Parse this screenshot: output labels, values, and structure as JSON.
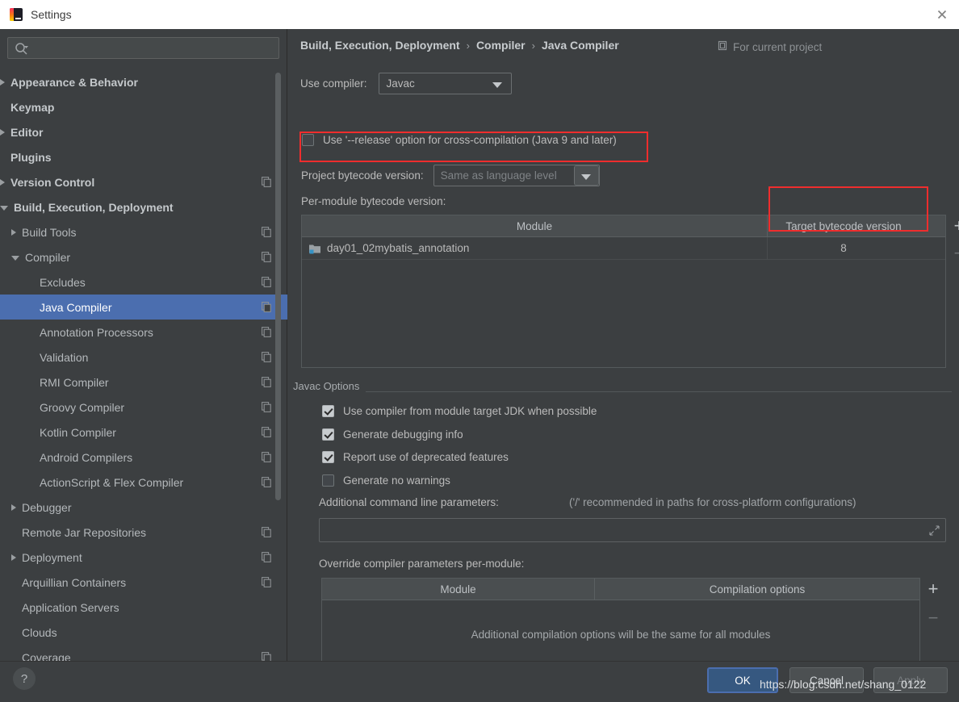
{
  "window": {
    "title": "Settings",
    "app_icon": "intellij-idea-icon",
    "close_icon": "close-icon"
  },
  "sidebar": {
    "search": {
      "placeholder": "",
      "value": "",
      "icon": "search-icon"
    },
    "items": [
      {
        "label": "Appearance & Behavior",
        "arrow": "right",
        "bold": true,
        "indent": 14,
        "copy": false
      },
      {
        "label": "Keymap",
        "arrow": "none",
        "bold": true,
        "indent": 14,
        "copy": false
      },
      {
        "label": "Editor",
        "arrow": "right",
        "bold": true,
        "indent": 14,
        "copy": false
      },
      {
        "label": "Plugins",
        "arrow": "none",
        "bold": true,
        "indent": 14,
        "copy": false
      },
      {
        "label": "Version Control",
        "arrow": "right",
        "bold": true,
        "indent": 14,
        "copy": true
      },
      {
        "label": "Build, Execution, Deployment",
        "arrow": "down",
        "bold": true,
        "indent": 14,
        "copy": false
      },
      {
        "label": "Build Tools",
        "arrow": "right",
        "bold": false,
        "indent": 34,
        "copy": true
      },
      {
        "label": "Compiler",
        "arrow": "down",
        "bold": false,
        "indent": 34,
        "copy": true
      },
      {
        "label": "Excludes",
        "arrow": "none",
        "bold": false,
        "indent": 56,
        "copy": true
      },
      {
        "label": "Java Compiler",
        "arrow": "none",
        "bold": false,
        "indent": 56,
        "copy": true,
        "selected": true
      },
      {
        "label": "Annotation Processors",
        "arrow": "none",
        "bold": false,
        "indent": 56,
        "copy": true
      },
      {
        "label": "Validation",
        "arrow": "none",
        "bold": false,
        "indent": 56,
        "copy": true
      },
      {
        "label": "RMI Compiler",
        "arrow": "none",
        "bold": false,
        "indent": 56,
        "copy": true
      },
      {
        "label": "Groovy Compiler",
        "arrow": "none",
        "bold": false,
        "indent": 56,
        "copy": true
      },
      {
        "label": "Kotlin Compiler",
        "arrow": "none",
        "bold": false,
        "indent": 56,
        "copy": true
      },
      {
        "label": "Android Compilers",
        "arrow": "none",
        "bold": false,
        "indent": 56,
        "copy": true
      },
      {
        "label": "ActionScript & Flex Compiler",
        "arrow": "none",
        "bold": false,
        "indent": 56,
        "copy": true
      },
      {
        "label": "Debugger",
        "arrow": "right",
        "bold": false,
        "indent": 34,
        "copy": false
      },
      {
        "label": "Remote Jar Repositories",
        "arrow": "none",
        "bold": false,
        "indent": 34,
        "copy": true
      },
      {
        "label": "Deployment",
        "arrow": "right",
        "bold": false,
        "indent": 34,
        "copy": true
      },
      {
        "label": "Arquillian Containers",
        "arrow": "none",
        "bold": false,
        "indent": 34,
        "copy": true
      },
      {
        "label": "Application Servers",
        "arrow": "none",
        "bold": false,
        "indent": 34,
        "copy": false
      },
      {
        "label": "Clouds",
        "arrow": "none",
        "bold": false,
        "indent": 34,
        "copy": false
      },
      {
        "label": "Coverage",
        "arrow": "none",
        "bold": false,
        "indent": 34,
        "copy": true
      }
    ]
  },
  "main": {
    "breadcrumb": {
      "part1": "Build, Execution, Deployment",
      "sep1": "›",
      "part2": "Compiler",
      "sep2": "›",
      "part3": "Java Compiler"
    },
    "for_project": {
      "label": "For current project",
      "icon": "project-scope-icon"
    },
    "use_compiler": {
      "label": "Use compiler:",
      "value": "Javac"
    },
    "release_option": {
      "label": "Use '--release' option for cross-compilation (Java 9 and later)",
      "checked": false
    },
    "project_bytecode": {
      "label": "Project bytecode version:",
      "value": "Same as language level"
    },
    "per_module_label": "Per-module bytecode version:",
    "module_table": {
      "columns": [
        "Module",
        "Target bytecode version"
      ],
      "rows": [
        {
          "module": "day01_02mybatis_annotation",
          "target": "8"
        }
      ],
      "add_label": "+",
      "remove_label": "−"
    },
    "javac_options": {
      "title": "Javac Options",
      "checkboxes": [
        {
          "label": "Use compiler from module target JDK when possible",
          "checked": true
        },
        {
          "label": "Generate debugging info",
          "checked": true
        },
        {
          "label": "Report use of deprecated features",
          "checked": true
        },
        {
          "label": "Generate no warnings",
          "checked": false
        }
      ],
      "additional_label": "Additional command line parameters:",
      "additional_hint": "('/' recommended in paths for cross-platform configurations)",
      "additional_value": "",
      "expand_icon": "expand-icon"
    },
    "override": {
      "label": "Override compiler parameters per-module:",
      "columns": [
        "Module",
        "Compilation options"
      ],
      "empty_text": "Additional compilation options will be the same for all modules",
      "add_label": "+",
      "remove_label": "−"
    }
  },
  "footer": {
    "help_label": "?",
    "ok_label": "OK",
    "cancel_label": "Cancel",
    "apply_label": "Apply"
  },
  "watermark": "https://blog.csdn.net/shang_0122",
  "colors": {
    "accent": "#4b6eaf",
    "primary_button": "#365880",
    "annotation": "#ef2d2d",
    "background": "#3c3f41"
  }
}
